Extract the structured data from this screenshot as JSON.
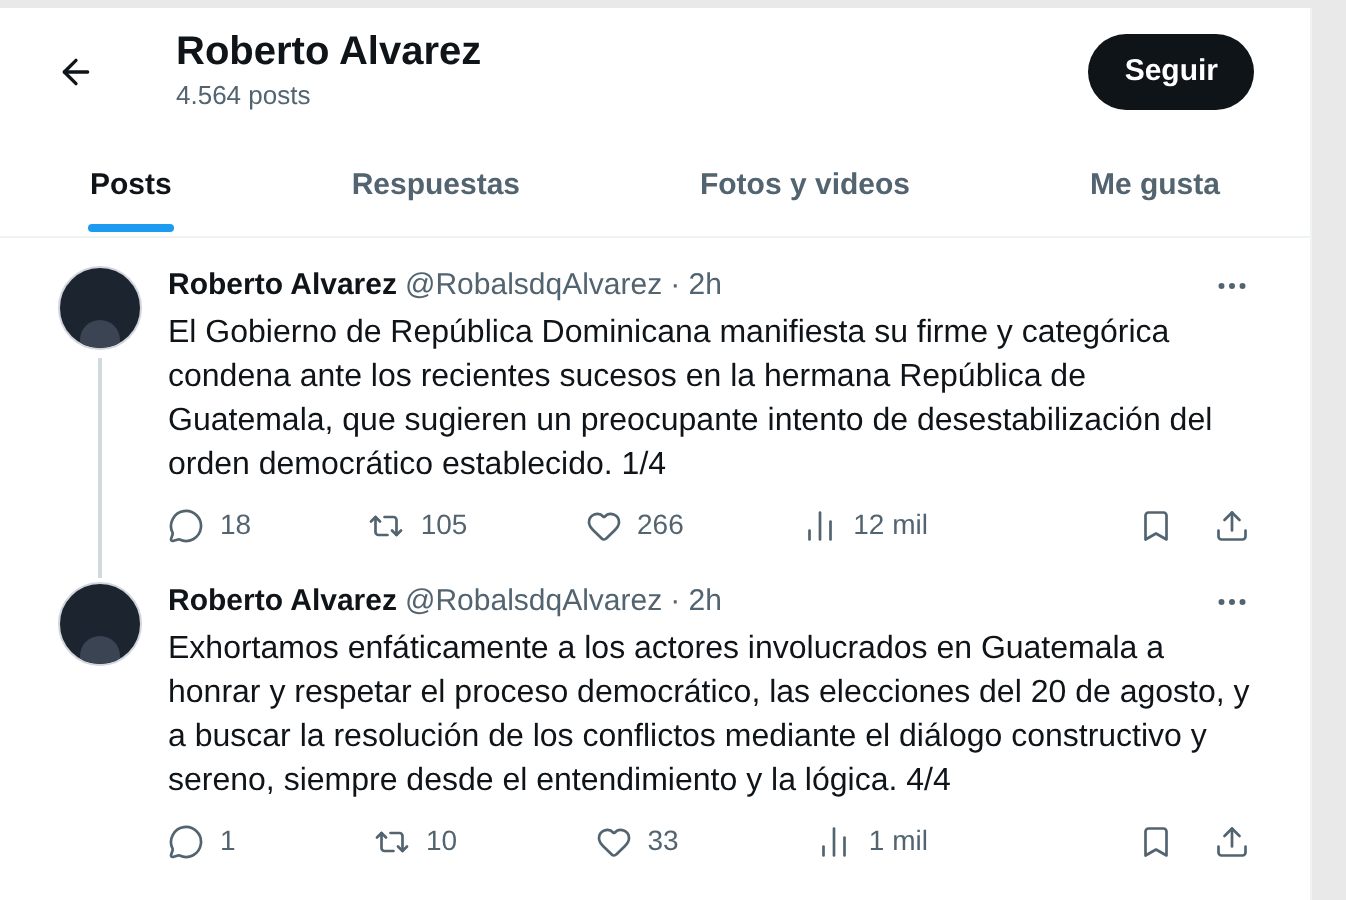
{
  "header": {
    "title": "Roberto Alvarez",
    "subtitle": "4.564 posts",
    "follow_button": "Seguir"
  },
  "tabs": [
    {
      "label": "Posts",
      "selected": true
    },
    {
      "label": "Respuestas",
      "selected": false
    },
    {
      "label": "Fotos y videos",
      "selected": false
    },
    {
      "label": "Me gusta",
      "selected": false
    }
  ],
  "posts": [
    {
      "name": "Roberto Alvarez",
      "handle": "@RobalsdqAlvarez",
      "time": "· 2h",
      "text": "El Gobierno de República Dominicana manifiesta su firme y categórica condena ante los recientes sucesos en la hermana República de Guatemala, que sugieren un preocupante intento de desestabilización del orden democrático establecido. 1/4",
      "replies": "18",
      "reposts": "105",
      "likes": "266",
      "views": "12 mil",
      "thread_continues": true
    },
    {
      "name": "Roberto Alvarez",
      "handle": "@RobalsdqAlvarez",
      "time": "· 2h",
      "text": "Exhortamos enfáticamente a los actores involucrados en Guatemala a honrar y respetar el proceso democrático, las elecciones del 20 de agosto, y a buscar la resolución de los conflictos mediante el diálogo constructivo y sereno, siempre desde el entendimiento y la lógica. 4/4",
      "replies": "1",
      "reposts": "10",
      "likes": "33",
      "views": "1 mil",
      "thread_continues": false
    }
  ]
}
